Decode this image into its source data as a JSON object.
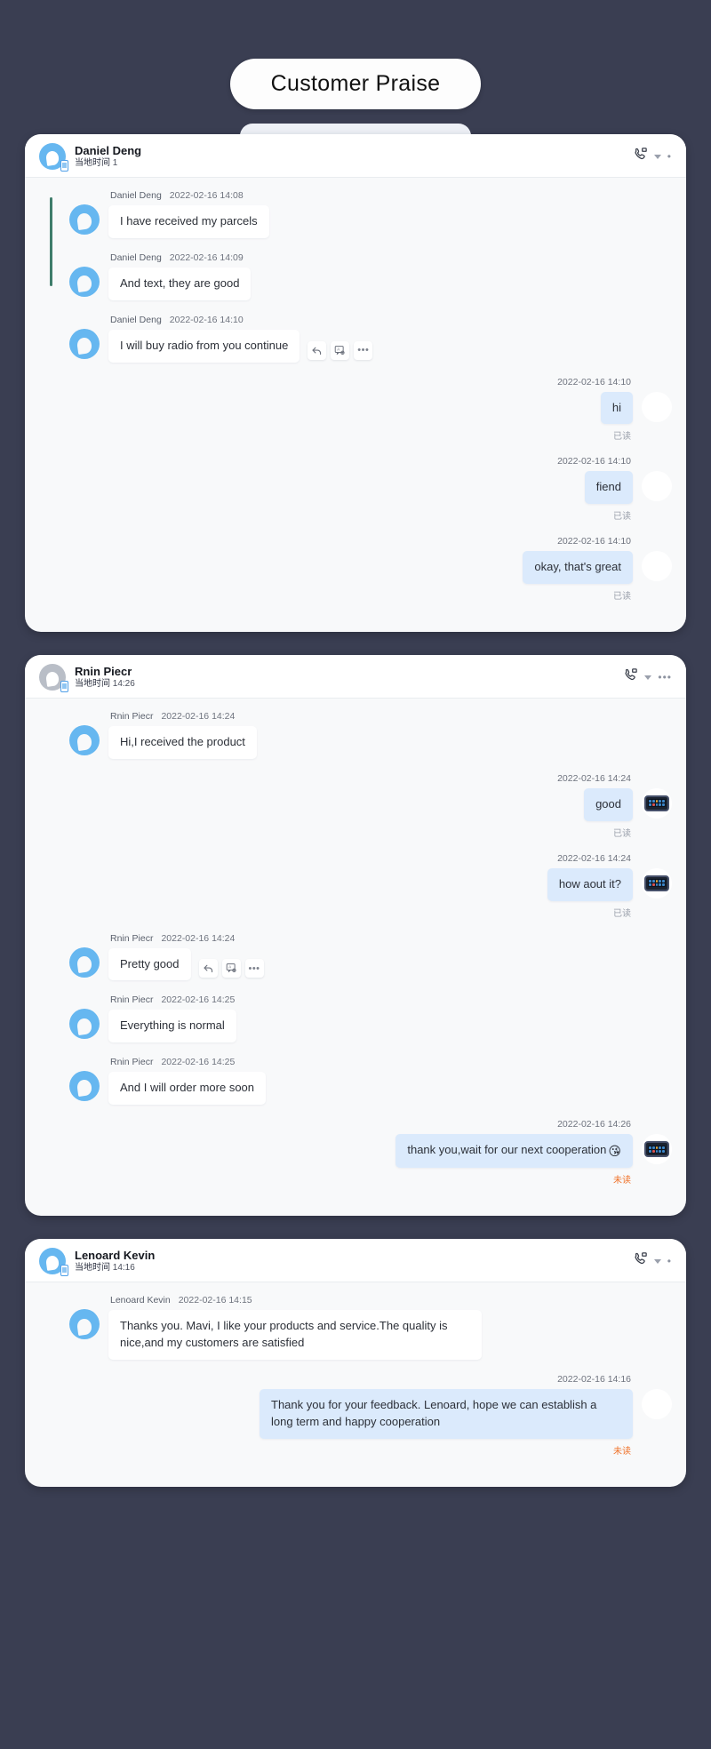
{
  "page": {
    "title": "Customer Praise",
    "background_color": "#3a3e52",
    "accent_color": "#66b7f0",
    "sent_bubble_color": "#dbeafc",
    "unread_color": "#f0732a"
  },
  "local_time_label": "当地时间",
  "read_label": "已读",
  "unread_label": "未读",
  "icons": {
    "phone": "phone-video-icon",
    "caret": "chevron-down-icon",
    "dots": "more-options-icon",
    "reply": "reply-icon",
    "translate": "translate-icon"
  },
  "chats": [
    {
      "name": "Daniel Deng",
      "local_time": "1",
      "avatar": "droplet-blue",
      "messages": [
        {
          "side": "in",
          "sender": "Daniel Deng",
          "time": "2022-02-16 14:08",
          "text": "I have received my parcels",
          "actions": false
        },
        {
          "side": "in",
          "sender": "Daniel Deng",
          "time": "2022-02-16 14:09",
          "text": "And text, they are good",
          "actions": false
        },
        {
          "side": "in",
          "sender": "Daniel Deng",
          "time": "2022-02-16 14:10",
          "text": "I will buy radio from you continue",
          "actions": true
        },
        {
          "side": "out",
          "time": "2022-02-16 14:10",
          "text": "hi",
          "status": "已读",
          "avatar": "woman-photo"
        },
        {
          "side": "out",
          "time": "2022-02-16 14:10",
          "text": "fiend",
          "status": "已读",
          "avatar": "woman-photo"
        },
        {
          "side": "out",
          "time": "2022-02-16 14:10",
          "text": "okay, that's great",
          "status": "已读",
          "avatar": "woman-photo"
        }
      ]
    },
    {
      "name": "Rnin Piecr",
      "local_time": "14:26",
      "avatar": "droplet-gray",
      "messages": [
        {
          "side": "in",
          "sender": "Rnin Piecr",
          "time": "2022-02-16 14:24",
          "text": "Hi,I received the product",
          "actions": false
        },
        {
          "side": "out",
          "time": "2022-02-16 14:24",
          "text": "good",
          "status": "已读",
          "avatar": "device-photo"
        },
        {
          "side": "out",
          "time": "2022-02-16 14:24",
          "text": "how aout it?",
          "status": "已读",
          "avatar": "device-photo"
        },
        {
          "side": "in",
          "sender": "Rnin Piecr",
          "time": "2022-02-16 14:24",
          "text": "Pretty good",
          "actions": true
        },
        {
          "side": "in",
          "sender": "Rnin Piecr",
          "time": "2022-02-16 14:25",
          "text": "Everything is normal",
          "actions": false
        },
        {
          "side": "in",
          "sender": "Rnin Piecr",
          "time": "2022-02-16 14:25",
          "text": "And I will order more soon",
          "actions": false
        },
        {
          "side": "out",
          "time": "2022-02-16 14:26",
          "text": "thank you,wait for our next cooperation",
          "emoji": "😘",
          "status": "未读",
          "unread": true,
          "avatar": "device-photo"
        }
      ]
    },
    {
      "name": "Lenoard Kevin",
      "local_time": "14:16",
      "avatar": "droplet-blue",
      "messages": [
        {
          "side": "in",
          "sender": "Lenoard Kevin",
          "time": "2022-02-16 14:15",
          "text": "Thanks you. Mavi, I like your products and service.The quality is nice,and my customers are satisfied",
          "actions": false
        },
        {
          "side": "out",
          "time": "2022-02-16 14:16",
          "text": "Thank you for your feedback. Lenoard, hope we can establish a long term and happy cooperation",
          "status": "未读",
          "unread": true,
          "avatar": "woman-photo-2"
        }
      ]
    }
  ]
}
